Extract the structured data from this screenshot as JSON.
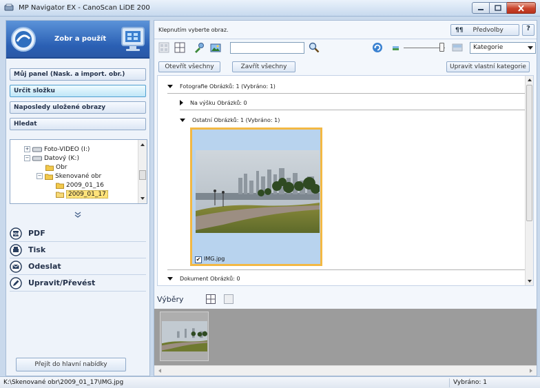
{
  "window": {
    "title": "MP Navigator EX - CanoScan LiDE 200"
  },
  "left_panel": {
    "banner_title": "Zobr a použít",
    "nav_items": [
      {
        "label": "Můj panel (Nask. a import. obr.)"
      },
      {
        "label": "Určit složku"
      },
      {
        "label": "Naposledy uložené obrazy"
      },
      {
        "label": "Hledat"
      }
    ],
    "tree": [
      {
        "label": "Foto-VIDEO (I:)"
      },
      {
        "label": "Datový (K:)"
      },
      {
        "label": "Obr"
      },
      {
        "label": "Skenované obr"
      },
      {
        "label": "2009_01_16"
      },
      {
        "label": "2009_01_17"
      }
    ],
    "actions": [
      {
        "label": "PDF",
        "icon": "pdf-icon"
      },
      {
        "label": "Tisk",
        "icon": "print-icon"
      },
      {
        "label": "Odeslat",
        "icon": "mail-icon"
      },
      {
        "label": "Upravit/Převést",
        "icon": "edit-icon"
      }
    ],
    "main_menu_label": "Přejít do hlavní nabídky"
  },
  "right_panel": {
    "hint": "Klepnutím vyberte obraz.",
    "preferences_label": "Předvolby",
    "help_label": "?",
    "search_value": "",
    "category_value": "Kategorie",
    "expand_all": "Otevřít všechny",
    "collapse_all": "Zavřít všechny",
    "edit_categories": "Upravit vlastní kategorie",
    "groups": {
      "photos": "Fotografie  Obrázků: 1   (Vybráno: 1)",
      "portrait": "Na výšku  Obrázků: 0",
      "other": "Ostatní  Obrázků: 1   (Vybráno: 1)",
      "document": "Dokument  Obrázků: 0"
    },
    "image_name": "IMG.jpg",
    "image_checked": "✔",
    "selections_label": "Výběry"
  },
  "status": {
    "path": "K:\\Skenované obr\\2009_01_17\\IMG.jpg",
    "selected": "Vybráno: 1"
  },
  "colors": {
    "banner": "#2a5fb3",
    "selection_border": "#f3b843",
    "thumb_bg": "#b8d3ee"
  }
}
